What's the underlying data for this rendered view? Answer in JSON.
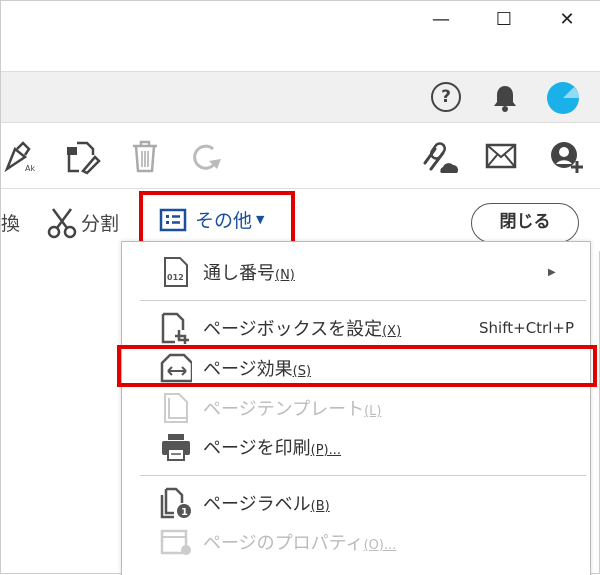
{
  "window_controls": {
    "minimize": "—",
    "maximize": "☐",
    "close": "✕"
  },
  "topbar": {
    "help": "?"
  },
  "toolbar2": {
    "convert_partial": "換",
    "split": "分割",
    "more": "その他",
    "close": "閉じる"
  },
  "menu": {
    "items": [
      {
        "label": "通し番号",
        "accel": "(N)",
        "submenu": true,
        "disabled": false
      },
      {
        "label": "ページボックスを設定",
        "accel": "(X)",
        "shortcut": "Shift+Ctrl+P",
        "disabled": false
      },
      {
        "label": "ページ効果",
        "accel": "(S)",
        "disabled": false,
        "highlighted": true
      },
      {
        "label": "ページテンプレート",
        "accel": "(L)",
        "disabled": true
      },
      {
        "label": "ページを印刷",
        "accel": "(P)...",
        "disabled": false
      },
      {
        "label": "ページラベル",
        "accel": "(B)",
        "disabled": false
      },
      {
        "label": "ページのプロパティ",
        "accel": "(O)...",
        "disabled": true
      }
    ]
  },
  "colors": {
    "accent": "#1a4f9c",
    "highlight_box": "#e00000",
    "avatar": "#1ab0e8"
  }
}
